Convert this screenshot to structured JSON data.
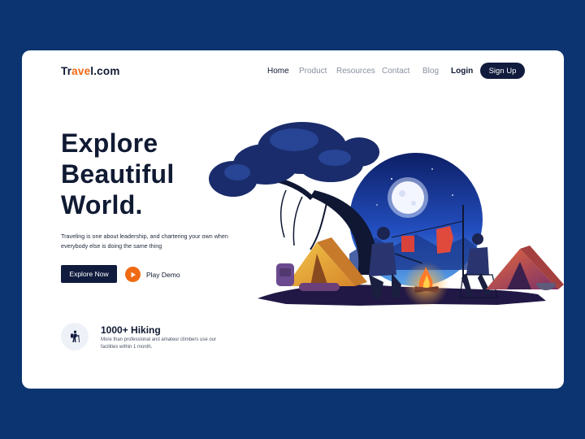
{
  "brand": {
    "prefix": "Tr",
    "accent": "ave",
    "suffix": "l.com"
  },
  "nav": {
    "items": [
      {
        "label": "Home",
        "active": true
      },
      {
        "label": "Product",
        "active": false
      },
      {
        "label": "Resources",
        "active": false
      },
      {
        "label": "Contact",
        "active": false
      },
      {
        "label": "Blog",
        "active": false
      }
    ],
    "login": "Login",
    "signup": "Sign Up"
  },
  "hero": {
    "title_line1": "Explore",
    "title_line2": "Beautiful",
    "title_line3": "World.",
    "description": "Traveling is one about leadership, and chartering your own when everybody else is doing the same thing",
    "explore_button": "Explore Now",
    "play_label": "Play Demo"
  },
  "stat": {
    "title": "1000+ Hiking",
    "description": "More than professional and amateur climbers use our facilities within 1 month."
  },
  "colors": {
    "page_bg": "#0b3470",
    "primary": "#101b3d",
    "accent": "#f06a14"
  },
  "icons": {
    "play": "play-icon",
    "hiker": "hiker-icon"
  }
}
